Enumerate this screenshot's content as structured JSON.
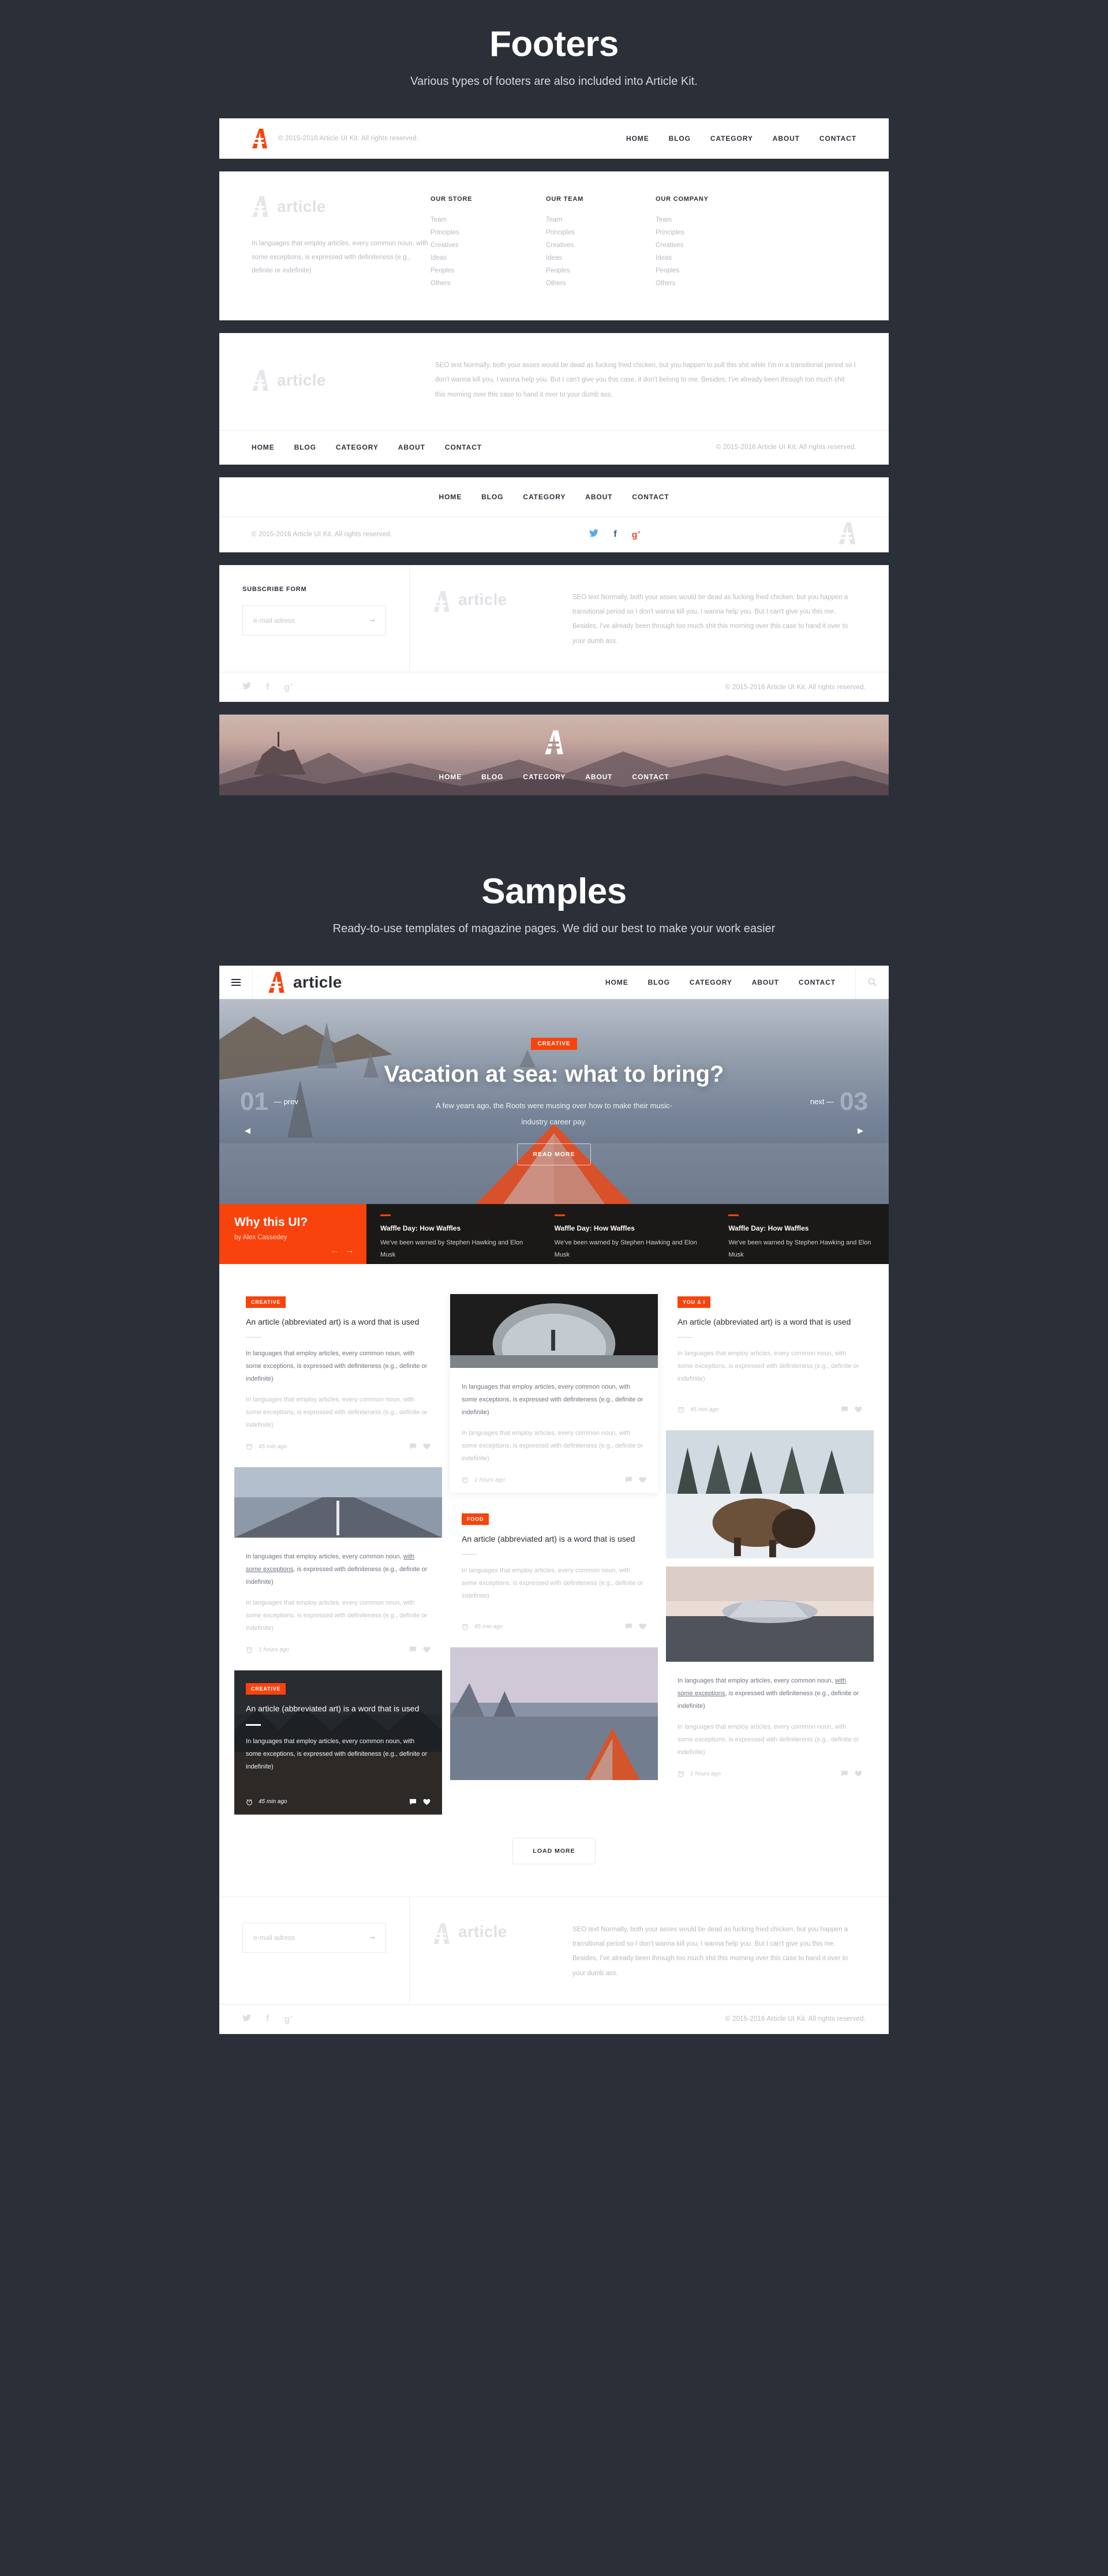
{
  "brand": {
    "name": "article",
    "mark": "a-logo-icon"
  },
  "colors": {
    "accent": "#f8430d",
    "dark_bg": "#2b2f38",
    "panel": "#ffffff"
  },
  "sections": {
    "footers": {
      "title": "Footers",
      "subtitle": "Various types of footers are also included into Article Kit."
    },
    "samples": {
      "title": "Samples",
      "subtitle": "Ready-to-use templates of magazine pages. We did our best to make your work easier"
    }
  },
  "nav": [
    "HOME",
    "BLOG",
    "CATEGORY",
    "ABOUT",
    "CONTACT"
  ],
  "copyright": "© 2015-2016 Article UI Kit. All rights reserved.",
  "lorem": {
    "article_desc": "In languages that employ articles, every common noun, with some exceptions, is expressed with definiteness (e.g., definite or indefinite)",
    "seo_full": "SEO text Normally, both your asses would be dead as fucking fried chicken, but you happen to pull this shit while I'm in a transitional period so I don't wanna kill you, I wanna help you. But I can't give you this case, it don't belong to me. Besides, I've already been through too much shit this morning over this case to hand it over to your dumb ass.",
    "seo_short": "SEO text Normally, both your asses would be dead as fucking fried chicken, but you happen a transitional period so I don't wanna kill you, I wanna help you. But I can't give you this me. Besides, I've already been through too much shit this morning over this case to hand it over to your dumb ass."
  },
  "footer_columns": [
    {
      "title": "OUR STORE",
      "items": [
        "Team",
        "Principles",
        "Creatives",
        "Ideas",
        "Peoples",
        "Others"
      ]
    },
    {
      "title": "OUR TEAM",
      "items": [
        "Team",
        "Principles",
        "Creatives",
        "Ideas",
        "Peoples",
        "Others"
      ]
    },
    {
      "title": "OUR COMPANY",
      "items": [
        "Team",
        "Principles",
        "Creatives",
        "Ideas",
        "Peoples",
        "Others"
      ]
    }
  ],
  "subscribe": {
    "title": "SUBSCRIBE FORM",
    "placeholder": "e-mail adress",
    "value": "",
    "submit_icon": "arrow-right-icon"
  },
  "socials": [
    {
      "name": "twitter-icon",
      "glyph": "🐦",
      "label": "twitter"
    },
    {
      "name": "facebook-icon",
      "glyph": "f",
      "label": "facebook"
    },
    {
      "name": "google-plus-icon",
      "glyph": "g+",
      "label": "google-plus"
    }
  ],
  "hero": {
    "badge": "CREATIVE",
    "title": "Vacation at sea: what to bring?",
    "description": "A few years ago, the Roots were musing over how to make their music-industry career pay.",
    "cta": "READ MORE",
    "prev_number": "01",
    "prev_label": "— prev",
    "next_number": "03",
    "next_label": "next —"
  },
  "featured": {
    "why_title": "Why this UI?",
    "why_author": "by Alex Cassedey",
    "items": [
      {
        "title": "Waffle Day: How Waffles",
        "text": "We've been warned by Stephen Hawking and Elon Musk"
      },
      {
        "title": "Waffle Day: How Waffles",
        "text": "We've been warned by Stephen Hawking and Elon Musk"
      },
      {
        "title": "Waffle Day: How Waffles",
        "text": "We've been warned by Stephen Hawking and Elon Musk"
      }
    ]
  },
  "cards": {
    "c1": {
      "badge": "CREATIVE",
      "title": "An article (abbreviated art) is a word that is used",
      "time": "45 min ago"
    },
    "c2": {
      "time": "1 hours ago"
    },
    "c3": {
      "time": "1 hours ago"
    },
    "c4": {
      "badge": "CREATIVE",
      "title": "An article (abbreviated art) is a word that is used",
      "time": "45 min ago"
    },
    "c5": {
      "time": "1 hours ago"
    },
    "c6": {
      "badge": "FOOD",
      "title": "An article (abbreviated art) is a word that is used",
      "time": "45 min ago"
    },
    "c7": {
      "badge": "YOU & I",
      "title": "An article (abbreviated art) is a word that is used",
      "time": "45 min ago"
    },
    "c8": {
      "time": "1 hours ago"
    }
  },
  "load_more": "LOAD MORE",
  "icons": {
    "clock": "alarm-clock-icon",
    "comment": "comment-icon",
    "heart": "heart-icon",
    "search": "search-icon",
    "burger": "hamburger-menu-icon"
  }
}
